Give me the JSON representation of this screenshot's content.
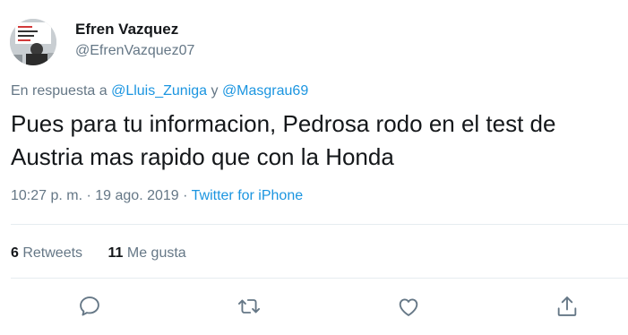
{
  "author": {
    "display_name": "Efren Vazquez",
    "handle": "@EfrenVazquez07"
  },
  "reply": {
    "prefix": "En respuesta a ",
    "user1": "@Lluis_Zuniga",
    "joiner": " y ",
    "user2": "@Masgrau69"
  },
  "tweet": {
    "text": "Pues para tu informacion, Pedrosa rodo en el test de Austria mas rapido que con la Honda"
  },
  "meta": {
    "time": "10:27 p. m.",
    "sep1": " · ",
    "date": "19 ago. 2019",
    "sep2": " · ",
    "source": "Twitter for iPhone"
  },
  "stats": {
    "retweets_count": "6",
    "retweets_label": " Retweets",
    "likes_count": "11",
    "likes_label": " Me gusta"
  },
  "icons": {
    "reply": "comment-bubble-icon",
    "retweet": "retweet-arrows-icon",
    "like": "heart-icon",
    "share": "share-upload-icon"
  },
  "colors": {
    "link": "#1b95e0",
    "muted": "#657786",
    "text": "#14171a",
    "divider": "#e6ecf0"
  }
}
